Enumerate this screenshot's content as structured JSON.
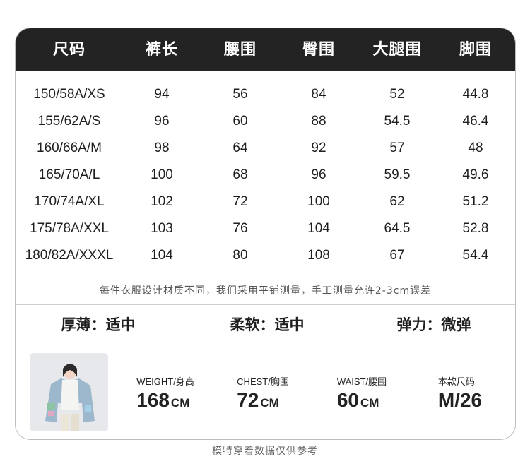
{
  "table": {
    "headers": [
      "尺码",
      "裤长",
      "腰围",
      "臀围",
      "大腿围",
      "脚围"
    ],
    "rows": [
      [
        "150/58A/XS",
        "94",
        "56",
        "84",
        "52",
        "44.8"
      ],
      [
        "155/62A/S",
        "96",
        "60",
        "88",
        "54.5",
        "46.4"
      ],
      [
        "160/66A/M",
        "98",
        "64",
        "92",
        "57",
        "48"
      ],
      [
        "165/70A/L",
        "100",
        "68",
        "96",
        "59.5",
        "49.6"
      ],
      [
        "170/74A/XL",
        "102",
        "72",
        "100",
        "62",
        "51.2"
      ],
      [
        "175/78A/XXL",
        "103",
        "76",
        "104",
        "64.5",
        "52.8"
      ],
      [
        "180/82A/XXXL",
        "104",
        "80",
        "108",
        "67",
        "54.4"
      ]
    ]
  },
  "note": "每件衣服设计材质不同，我们采用平铺测量，手工测量允许2-3cm误差",
  "properties": [
    {
      "label": "厚薄：适中"
    },
    {
      "label": "柔软：适中"
    },
    {
      "label": "弹力：微弹"
    }
  ],
  "model": {
    "stats": [
      {
        "label": "WEIGHT/身高",
        "value": "168",
        "unit": "CM"
      },
      {
        "label": "CHEST/胸围",
        "value": "72",
        "unit": "CM"
      },
      {
        "label": "WAIST/腰围",
        "value": "60",
        "unit": "CM"
      },
      {
        "label": "本款尺码",
        "value": "M/26",
        "unit": ""
      }
    ]
  },
  "footer": "模特穿着数据仅供参考"
}
